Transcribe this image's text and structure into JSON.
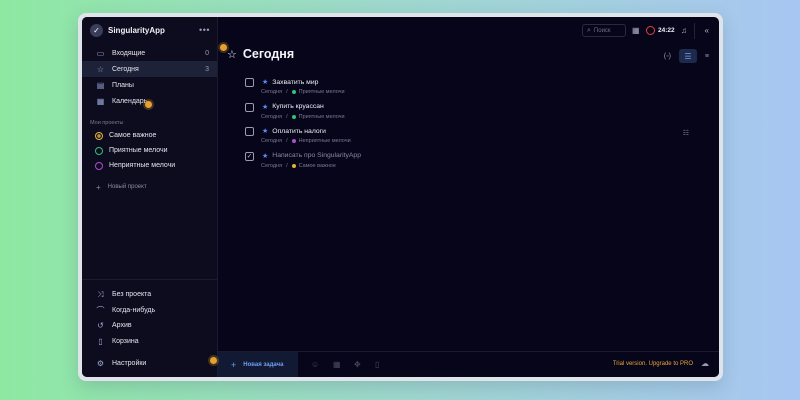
{
  "app": {
    "name": "SingularityApp",
    "menu_icon": "ellipsis-icon"
  },
  "sidebar": {
    "main_items": [
      {
        "label": "Входящие",
        "count": "0",
        "icon": "inbox-icon"
      },
      {
        "label": "Сегодня",
        "count": "3",
        "icon": "star-icon",
        "active": true
      },
      {
        "label": "Планы",
        "count": "",
        "icon": "plans-icon"
      },
      {
        "label": "Календарь",
        "count": "",
        "icon": "calendar-icon"
      }
    ],
    "projects_title": "Мои проекты",
    "projects": [
      {
        "label": "Самое важное",
        "color": "#e0b23a"
      },
      {
        "label": "Приятные мелочи",
        "color": "#33c27a"
      },
      {
        "label": "Неприятные мелочи",
        "color": "#b04bd0"
      }
    ],
    "new_project_label": "Новый проект",
    "bottom_items": [
      {
        "label": "Без проекта",
        "icon": "no-project-icon"
      },
      {
        "label": "Когда-нибудь",
        "icon": "rainbow-icon"
      },
      {
        "label": "Архив",
        "icon": "archive-icon"
      },
      {
        "label": "Корзина",
        "icon": "trash-icon"
      }
    ],
    "settings_label": "Настройки"
  },
  "topbar": {
    "search_placeholder": "Поиск",
    "timer": "24:22"
  },
  "main": {
    "title": "Сегодня",
    "tasks": [
      {
        "title": "Захватить мир",
        "date": "Сегодня",
        "project": "Приятные мелочи",
        "project_color": "#33c27a",
        "done": false
      },
      {
        "title": "Купить круассан",
        "date": "Сегодня",
        "project": "Приятные мелочи",
        "project_color": "#33c27a",
        "done": false
      },
      {
        "title": "Оплатить налоги",
        "date": "Сегодня",
        "project": "Неприятные мелочи",
        "project_color": "#b04bd0",
        "done": false
      },
      {
        "title": "Написать про SingularityApp",
        "date": "Сегодня",
        "project": "Самое важное",
        "project_color": "#e0b23a",
        "done": true
      }
    ]
  },
  "bottombar": {
    "new_task_label": "Новая задача",
    "trial_text": "Trial version. Upgrade to PRO"
  },
  "colors": {
    "accent": "#6e9ef2",
    "hint_dot": "#e5a02d",
    "trial": "#e8a53a"
  }
}
